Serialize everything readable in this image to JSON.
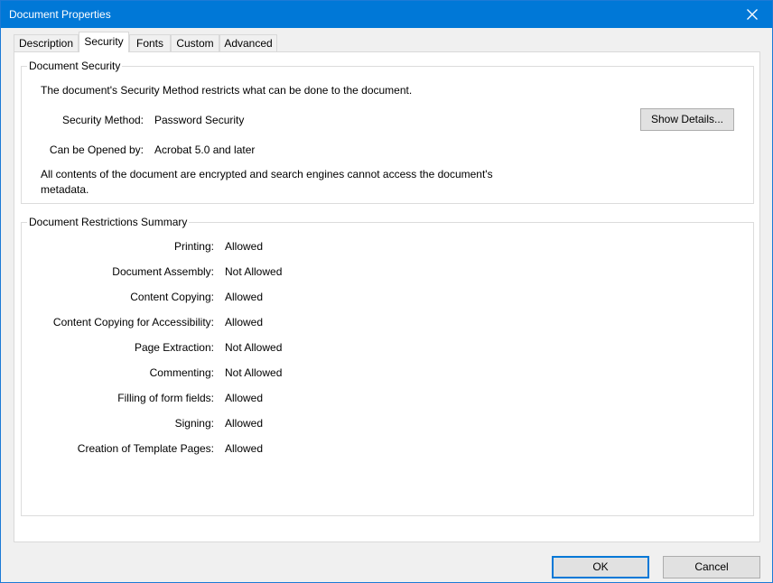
{
  "window": {
    "title": "Document Properties"
  },
  "tabs": [
    {
      "label": "Description"
    },
    {
      "label": "Security"
    },
    {
      "label": "Fonts"
    },
    {
      "label": "Custom"
    },
    {
      "label": "Advanced"
    }
  ],
  "active_tab": "Security",
  "document_security": {
    "group_label": "Document Security",
    "intro": "The document's Security Method restricts what can be done to the document.",
    "method_label": "Security Method:",
    "method_value": "Password Security",
    "opened_label": "Can be Opened by:",
    "opened_value": "Acrobat 5.0 and later",
    "show_details_label": "Show Details...",
    "note": "All contents of the document are encrypted and search engines cannot access the document's metadata."
  },
  "restrictions": {
    "group_label": "Document Restrictions Summary",
    "rows": [
      {
        "label": "Printing:",
        "value": "Allowed"
      },
      {
        "label": "Document Assembly:",
        "value": "Not Allowed"
      },
      {
        "label": "Content Copying:",
        "value": "Allowed"
      },
      {
        "label": "Content Copying for Accessibility:",
        "value": "Allowed"
      },
      {
        "label": "Page Extraction:",
        "value": "Not Allowed"
      },
      {
        "label": "Commenting:",
        "value": "Not Allowed"
      },
      {
        "label": "Filling of form fields:",
        "value": "Allowed"
      },
      {
        "label": "Signing:",
        "value": "Allowed"
      },
      {
        "label": "Creation of Template Pages:",
        "value": "Allowed"
      }
    ]
  },
  "footer": {
    "ok_label": "OK",
    "cancel_label": "Cancel"
  },
  "colors": {
    "titlebar": "#0078d7",
    "dialog_bg": "#f0f0f0",
    "panel_bg": "#ffffff",
    "default_button_border": "#0078d7"
  }
}
